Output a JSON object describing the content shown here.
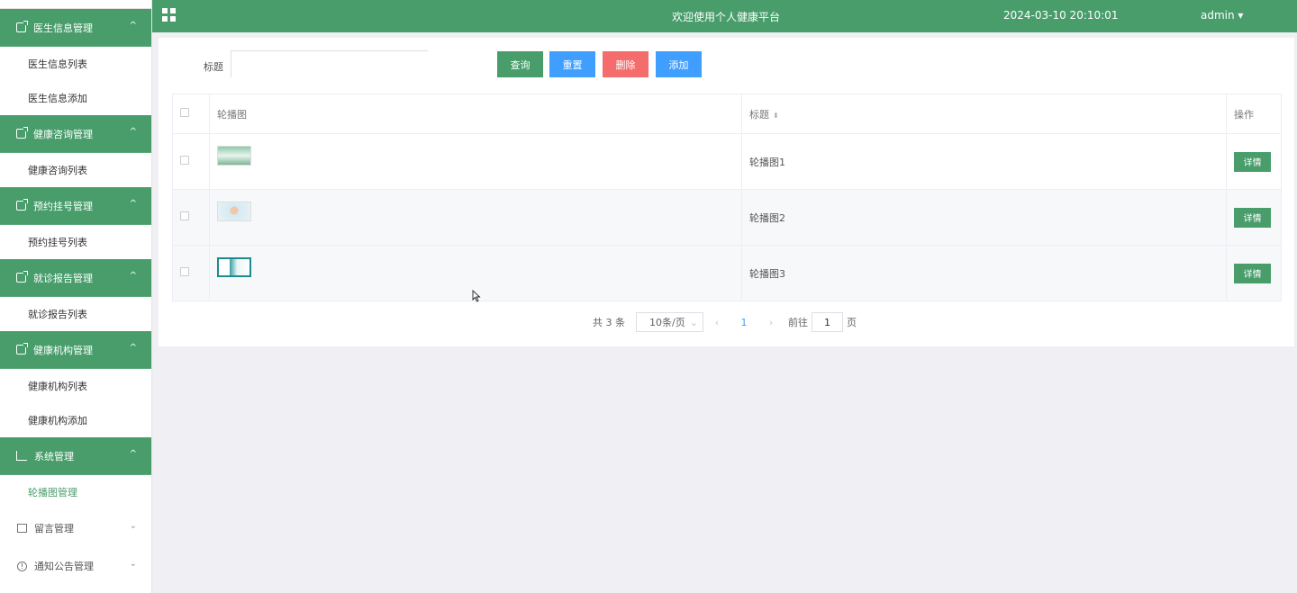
{
  "header": {
    "title": "欢迎使用个人健康平台",
    "datetime": "2024-03-10 20:10:01",
    "user": "admin"
  },
  "sidebar": {
    "groups": [
      {
        "label": "医生信息管理",
        "items": [
          "医生信息列表",
          "医生信息添加"
        ]
      },
      {
        "label": "健康咨询管理",
        "items": [
          "健康咨询列表"
        ]
      },
      {
        "label": "预约挂号管理",
        "items": [
          "预约挂号列表"
        ]
      },
      {
        "label": "就诊报告管理",
        "items": [
          "就诊报告列表"
        ]
      },
      {
        "label": "健康机构管理",
        "items": [
          "健康机构列表",
          "健康机构添加"
        ]
      },
      {
        "label": "系统管理",
        "items": [
          "轮播图管理"
        ]
      }
    ],
    "collapsed": [
      {
        "label": "留言管理"
      },
      {
        "label": "通知公告管理"
      }
    ]
  },
  "search": {
    "label": "标题",
    "value": "",
    "placeholder": ""
  },
  "buttons": {
    "query": "查询",
    "reset": "重置",
    "delete": "删除",
    "add": "添加"
  },
  "table": {
    "columns": [
      "轮播图",
      "标题",
      "操作"
    ],
    "rows": [
      {
        "title": "轮播图1",
        "action": "详情"
      },
      {
        "title": "轮播图2",
        "action": "详情"
      },
      {
        "title": "轮播图3",
        "action": "详情"
      }
    ]
  },
  "pagination": {
    "total": "共 3 条",
    "page_size": "10条/页",
    "current_page": "1",
    "goto_prefix": "前往",
    "goto_value": "1",
    "goto_suffix": "页"
  },
  "colors": {
    "primary": "#489d6b",
    "blue": "#409eff",
    "red": "#f56c6c"
  }
}
